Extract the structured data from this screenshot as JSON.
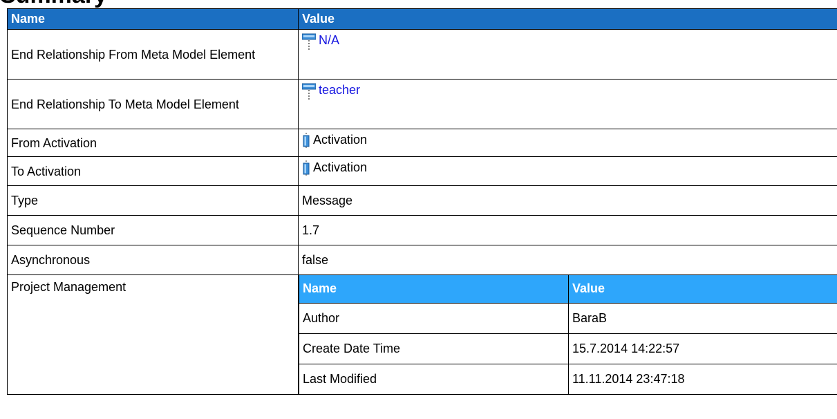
{
  "heading": "Summary",
  "table": {
    "headers": {
      "name": "Name",
      "value": "Value"
    },
    "rows": [
      {
        "name": "End Relationship From Meta Model Element",
        "value": "N/A",
        "icon": "meta-model-element-icon",
        "link": true
      },
      {
        "name": "End Relationship To Meta Model Element",
        "value": "teacher",
        "icon": "meta-model-element-icon",
        "link": true
      },
      {
        "name": "From Activation",
        "value": "Activation",
        "icon": "activation-icon",
        "link": false
      },
      {
        "name": "To Activation",
        "value": "Activation",
        "icon": "activation-icon",
        "link": false
      },
      {
        "name": "Type",
        "value": "Message"
      },
      {
        "name": "Sequence Number",
        "value": "1.7"
      },
      {
        "name": "Asynchronous",
        "value": "false"
      }
    ],
    "project_management": {
      "name": "Project Management",
      "headers": {
        "name": "Name",
        "value": "Value"
      },
      "rows": [
        {
          "name": "Author",
          "value": "BaraB"
        },
        {
          "name": "Create Date Time",
          "value": "15.7.2014 14:22:57"
        },
        {
          "name": "Last Modified",
          "value": "11.11.2014 23:47:18"
        }
      ]
    }
  },
  "colors": {
    "header": "#1b6fc2",
    "subheader": "#2ea6fb",
    "link": "#1515e0"
  }
}
